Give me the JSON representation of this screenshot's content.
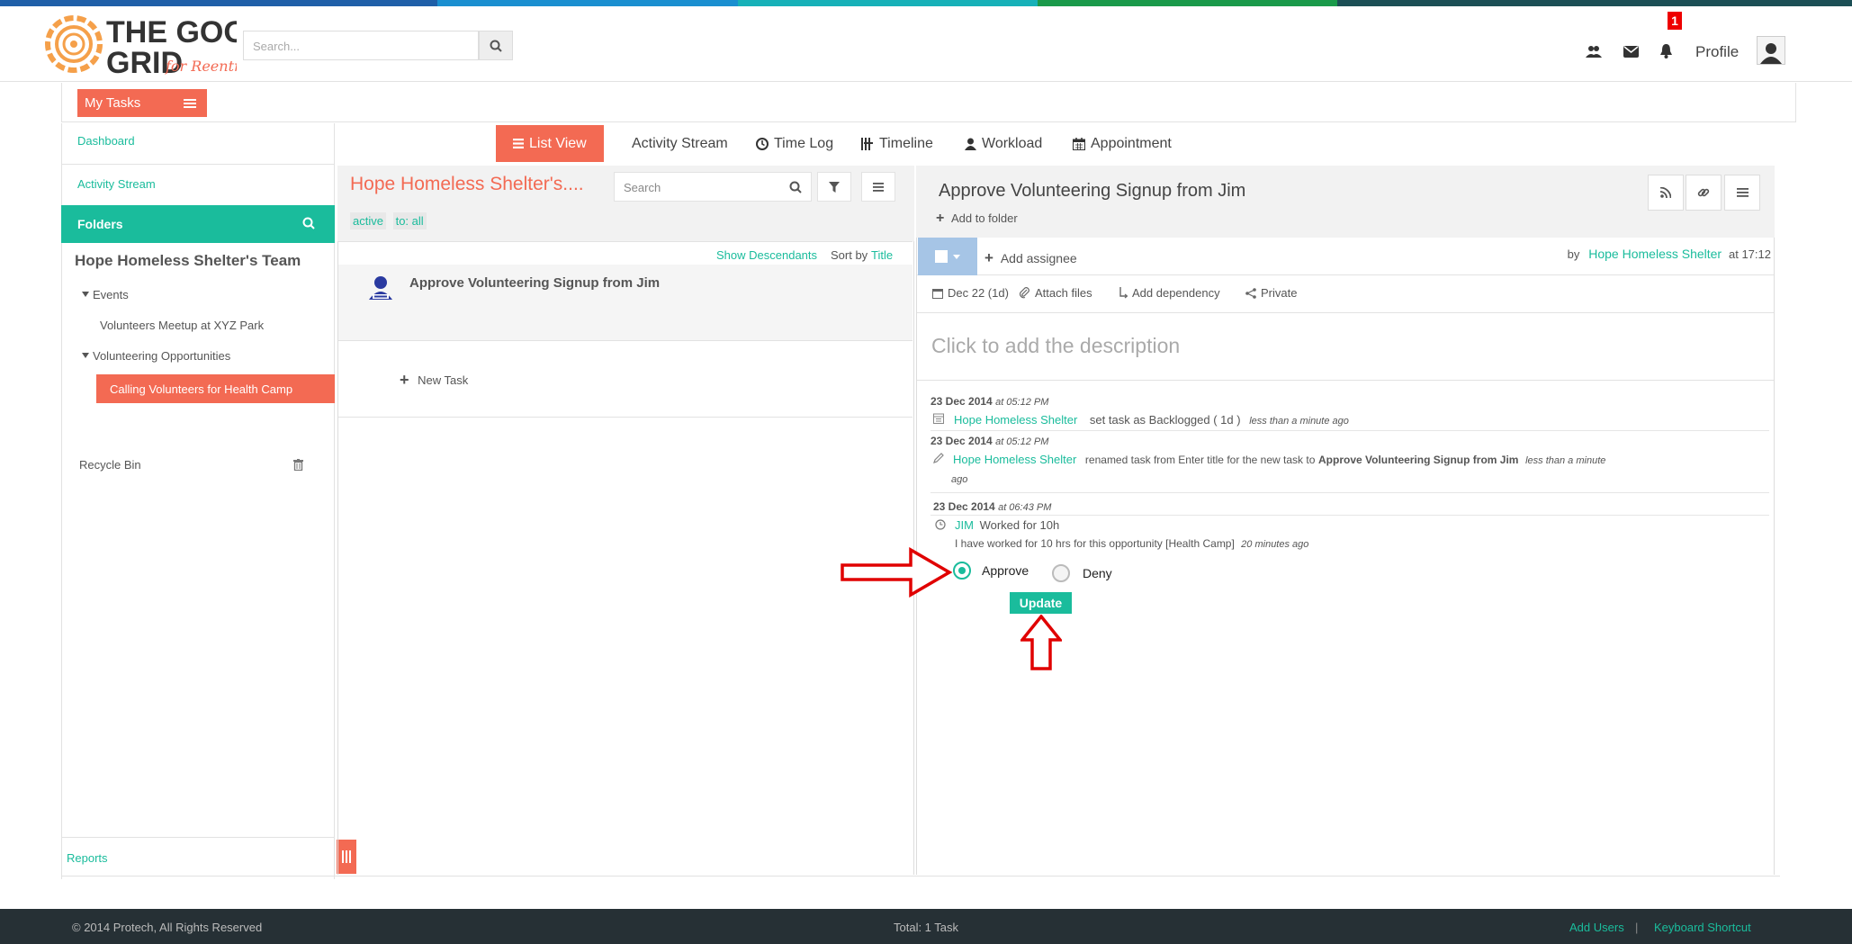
{
  "colors": {
    "accent_orange": "#f36a53",
    "accent_teal": "#1abc9c",
    "footer_bg": "#263035",
    "annotation_red": "#e00000",
    "top_stripe": [
      "#1f5fa8",
      "#1a8fd0",
      "#17b1b8",
      "#1a9a4a",
      "#1c4f55"
    ]
  },
  "header": {
    "logo_text_top": "THE GOOD",
    "logo_text_bottom": "GRID",
    "logo_tagline": "for Reentry",
    "search_placeholder": "Search...",
    "notification_count": "1",
    "profile_label": "Profile",
    "icons": [
      "users-icon",
      "envelope-icon",
      "bell-icon",
      "user-avatar-icon"
    ]
  },
  "tasks_bar": {
    "label": "My Tasks"
  },
  "sidebar": {
    "dashboard": "Dashboard",
    "activity_stream": "Activity Stream",
    "folders": "Folders",
    "team_title": "Hope Homeless Shelter's Team",
    "tree": [
      {
        "label": "Events",
        "level": 1,
        "expanded": true
      },
      {
        "label": "Volunteers Meetup at XYZ Park",
        "level": 2
      },
      {
        "label": "Volunteering Opportunities",
        "level": 1,
        "expanded": true
      },
      {
        "label": "Calling Volunteers for Health Camp",
        "level": 2,
        "selected": true
      }
    ],
    "recycle_bin": "Recycle Bin",
    "reports": "Reports"
  },
  "view_tabs": [
    {
      "label": "List View",
      "icon": "list-icon",
      "active": true
    },
    {
      "label": "Activity Stream",
      "icon": "",
      "active": false
    },
    {
      "label": "Time Log",
      "icon": "clock-icon",
      "active": false
    },
    {
      "label": "Timeline",
      "icon": "timeline-icon",
      "active": false
    },
    {
      "label": "Workload",
      "icon": "person-icon",
      "active": false
    },
    {
      "label": "Appointment",
      "icon": "calendar-icon",
      "active": false
    }
  ],
  "task_list": {
    "folder_title": "Hope Homeless Shelter's....",
    "search_placeholder": "Search",
    "filters": [
      "active",
      "to: all"
    ],
    "show_descendants": "Show Descendants",
    "sort_by": "Sort by",
    "sort_field": "Title",
    "tasks": [
      {
        "title": "Approve Volunteering Signup from Jim"
      }
    ],
    "new_task": "New Task"
  },
  "task_detail": {
    "title": "Approve Volunteering Signup from Jim",
    "add_to_folder": "Add to folder",
    "add_assignee": "Add assignee",
    "by_label": "by",
    "author": "Hope Homeless Shelter",
    "created_time": "at 17:12",
    "due_date": "Dec 22 (1d)",
    "attach_files": "Attach files",
    "add_dependency": "Add dependency",
    "private": "Private",
    "description_placeholder": "Click to add the description",
    "activity": [
      {
        "date": "23 Dec 2014",
        "time": "at 05:12 PM",
        "user": "Hope Homeless Shelter",
        "text": "set task as Backlogged ( 1d )",
        "ago": "less than a minute ago"
      },
      {
        "date": "23 Dec 2014",
        "time": "at 05:12 PM",
        "user": "Hope Homeless Shelter",
        "text_pre": "renamed task from Enter title for the new task to",
        "text_bold": "Approve Volunteering Signup from Jim",
        "ago": "less than a minute",
        "ago2": "ago"
      },
      {
        "date": "23 Dec 2014",
        "time": "at 06:43 PM",
        "user": "JIM",
        "text": "Worked for 10h",
        "note": "I have worked for 10 hrs for this opportunity [Health Camp]",
        "ago": "20 minutes ago"
      }
    ],
    "approve_label": "Approve",
    "deny_label": "Deny",
    "selected_option": "Approve",
    "update_button": "Update"
  },
  "footer": {
    "copyright": "© 2014 Protech, All Rights Reserved",
    "total": "Total: 1 Task",
    "add_users": "Add Users",
    "separator": "|",
    "keyboard_shortcut": "Keyboard Shortcut"
  }
}
